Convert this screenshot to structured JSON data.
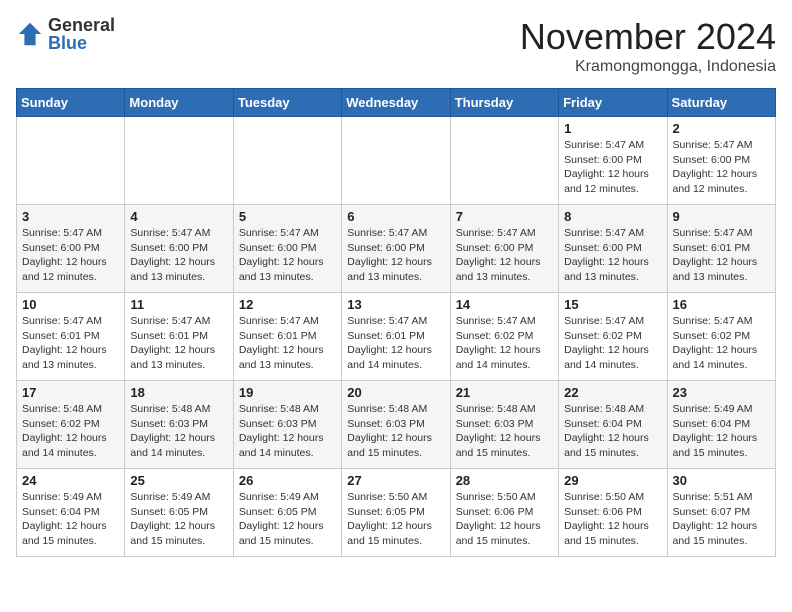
{
  "logo": {
    "general": "General",
    "blue": "Blue"
  },
  "header": {
    "month": "November 2024",
    "location": "Kramongmongga, Indonesia"
  },
  "weekdays": [
    "Sunday",
    "Monday",
    "Tuesday",
    "Wednesday",
    "Thursday",
    "Friday",
    "Saturday"
  ],
  "weeks": [
    [
      {
        "day": "",
        "info": ""
      },
      {
        "day": "",
        "info": ""
      },
      {
        "day": "",
        "info": ""
      },
      {
        "day": "",
        "info": ""
      },
      {
        "day": "",
        "info": ""
      },
      {
        "day": "1",
        "info": "Sunrise: 5:47 AM\nSunset: 6:00 PM\nDaylight: 12 hours and 12 minutes."
      },
      {
        "day": "2",
        "info": "Sunrise: 5:47 AM\nSunset: 6:00 PM\nDaylight: 12 hours and 12 minutes."
      }
    ],
    [
      {
        "day": "3",
        "info": "Sunrise: 5:47 AM\nSunset: 6:00 PM\nDaylight: 12 hours and 12 minutes."
      },
      {
        "day": "4",
        "info": "Sunrise: 5:47 AM\nSunset: 6:00 PM\nDaylight: 12 hours and 13 minutes."
      },
      {
        "day": "5",
        "info": "Sunrise: 5:47 AM\nSunset: 6:00 PM\nDaylight: 12 hours and 13 minutes."
      },
      {
        "day": "6",
        "info": "Sunrise: 5:47 AM\nSunset: 6:00 PM\nDaylight: 12 hours and 13 minutes."
      },
      {
        "day": "7",
        "info": "Sunrise: 5:47 AM\nSunset: 6:00 PM\nDaylight: 12 hours and 13 minutes."
      },
      {
        "day": "8",
        "info": "Sunrise: 5:47 AM\nSunset: 6:00 PM\nDaylight: 12 hours and 13 minutes."
      },
      {
        "day": "9",
        "info": "Sunrise: 5:47 AM\nSunset: 6:01 PM\nDaylight: 12 hours and 13 minutes."
      }
    ],
    [
      {
        "day": "10",
        "info": "Sunrise: 5:47 AM\nSunset: 6:01 PM\nDaylight: 12 hours and 13 minutes."
      },
      {
        "day": "11",
        "info": "Sunrise: 5:47 AM\nSunset: 6:01 PM\nDaylight: 12 hours and 13 minutes."
      },
      {
        "day": "12",
        "info": "Sunrise: 5:47 AM\nSunset: 6:01 PM\nDaylight: 12 hours and 13 minutes."
      },
      {
        "day": "13",
        "info": "Sunrise: 5:47 AM\nSunset: 6:01 PM\nDaylight: 12 hours and 14 minutes."
      },
      {
        "day": "14",
        "info": "Sunrise: 5:47 AM\nSunset: 6:02 PM\nDaylight: 12 hours and 14 minutes."
      },
      {
        "day": "15",
        "info": "Sunrise: 5:47 AM\nSunset: 6:02 PM\nDaylight: 12 hours and 14 minutes."
      },
      {
        "day": "16",
        "info": "Sunrise: 5:47 AM\nSunset: 6:02 PM\nDaylight: 12 hours and 14 minutes."
      }
    ],
    [
      {
        "day": "17",
        "info": "Sunrise: 5:48 AM\nSunset: 6:02 PM\nDaylight: 12 hours and 14 minutes."
      },
      {
        "day": "18",
        "info": "Sunrise: 5:48 AM\nSunset: 6:03 PM\nDaylight: 12 hours and 14 minutes."
      },
      {
        "day": "19",
        "info": "Sunrise: 5:48 AM\nSunset: 6:03 PM\nDaylight: 12 hours and 14 minutes."
      },
      {
        "day": "20",
        "info": "Sunrise: 5:48 AM\nSunset: 6:03 PM\nDaylight: 12 hours and 15 minutes."
      },
      {
        "day": "21",
        "info": "Sunrise: 5:48 AM\nSunset: 6:03 PM\nDaylight: 12 hours and 15 minutes."
      },
      {
        "day": "22",
        "info": "Sunrise: 5:48 AM\nSunset: 6:04 PM\nDaylight: 12 hours and 15 minutes."
      },
      {
        "day": "23",
        "info": "Sunrise: 5:49 AM\nSunset: 6:04 PM\nDaylight: 12 hours and 15 minutes."
      }
    ],
    [
      {
        "day": "24",
        "info": "Sunrise: 5:49 AM\nSunset: 6:04 PM\nDaylight: 12 hours and 15 minutes."
      },
      {
        "day": "25",
        "info": "Sunrise: 5:49 AM\nSunset: 6:05 PM\nDaylight: 12 hours and 15 minutes."
      },
      {
        "day": "26",
        "info": "Sunrise: 5:49 AM\nSunset: 6:05 PM\nDaylight: 12 hours and 15 minutes."
      },
      {
        "day": "27",
        "info": "Sunrise: 5:50 AM\nSunset: 6:05 PM\nDaylight: 12 hours and 15 minutes."
      },
      {
        "day": "28",
        "info": "Sunrise: 5:50 AM\nSunset: 6:06 PM\nDaylight: 12 hours and 15 minutes."
      },
      {
        "day": "29",
        "info": "Sunrise: 5:50 AM\nSunset: 6:06 PM\nDaylight: 12 hours and 15 minutes."
      },
      {
        "day": "30",
        "info": "Sunrise: 5:51 AM\nSunset: 6:07 PM\nDaylight: 12 hours and 15 minutes."
      }
    ]
  ]
}
